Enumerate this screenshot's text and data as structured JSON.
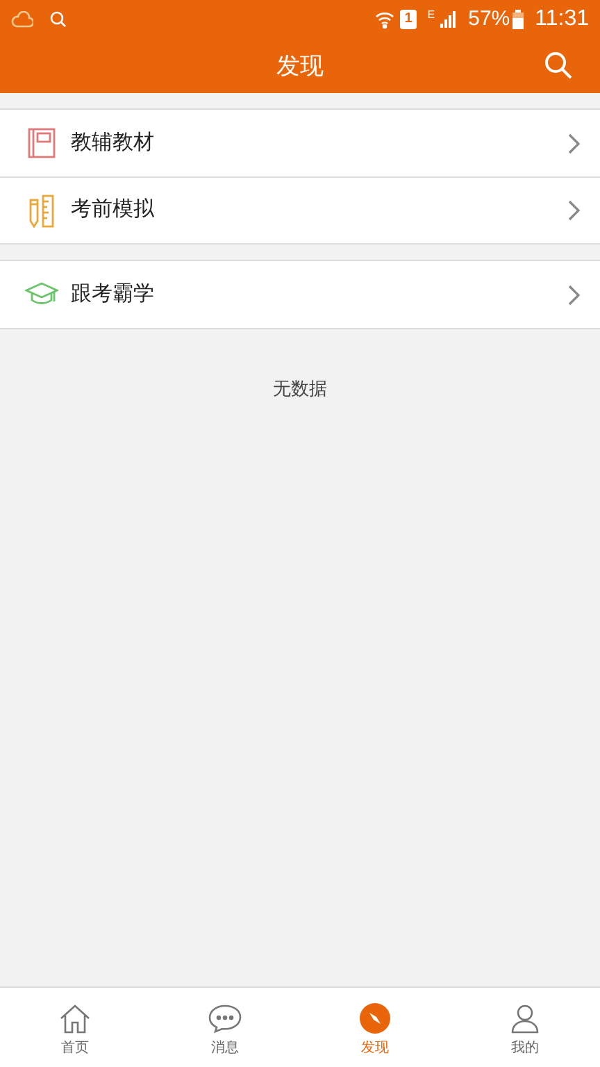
{
  "status_bar": {
    "sim": "1",
    "network": "E",
    "battery": "57%",
    "time": "11:31"
  },
  "header": {
    "title": "发现"
  },
  "groups": [
    {
      "items": [
        {
          "label": "教辅教材",
          "kind": "book"
        },
        {
          "label": "考前模拟",
          "kind": "ruler"
        }
      ]
    },
    {
      "items": [
        {
          "label": "跟考霸学",
          "kind": "cap"
        }
      ]
    }
  ],
  "empty_text": "无数据",
  "bottom_nav": [
    {
      "label": "首页",
      "kind": "home",
      "selected": false
    },
    {
      "label": "消息",
      "kind": "chat",
      "selected": false
    },
    {
      "label": "发现",
      "kind": "compass",
      "selected": true
    },
    {
      "label": "我的",
      "kind": "person",
      "selected": false
    }
  ]
}
